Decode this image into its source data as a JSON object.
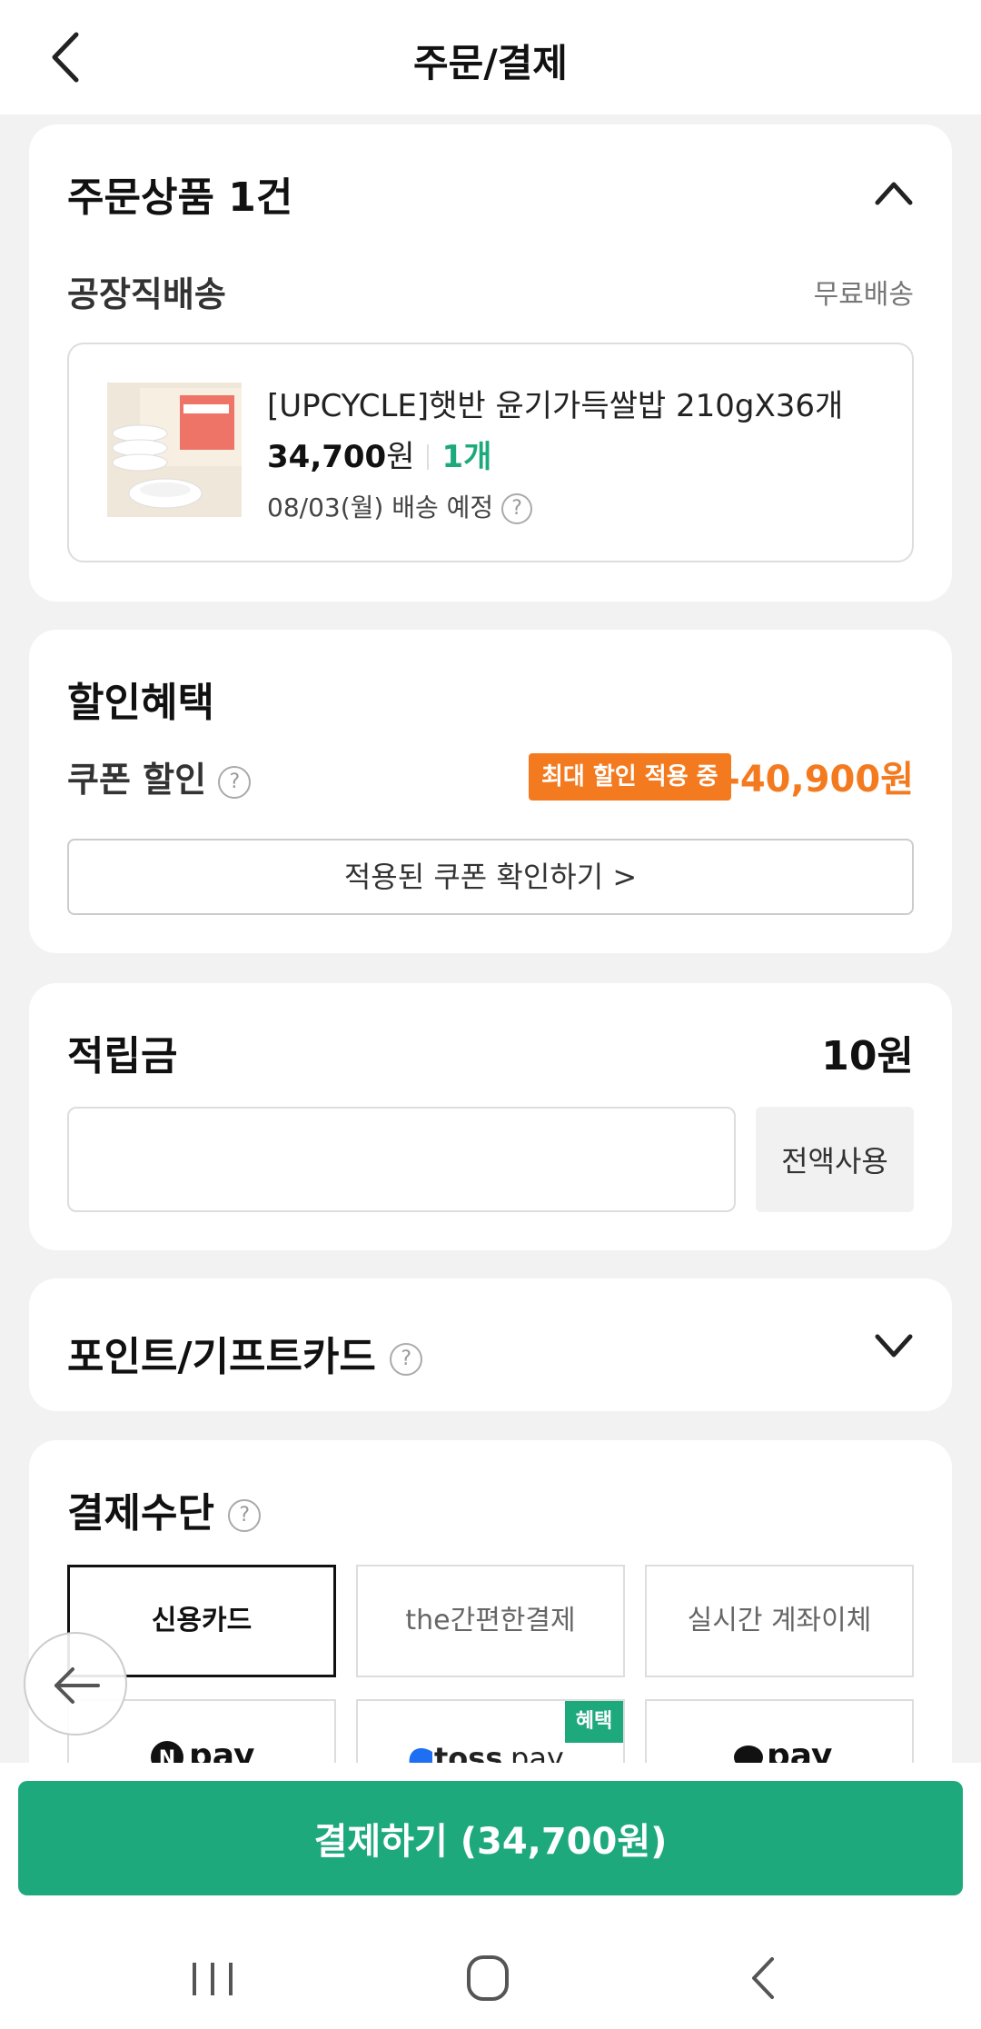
{
  "header": {
    "title": "주문/결제"
  },
  "order": {
    "title": "주문상품 1건",
    "shipping_type": "공장직배송",
    "shipping_fee": "무료배송",
    "product": {
      "name": "[UPCYCLE]햇반 윤기가득쌀밥 210gX36개",
      "price": "34,700",
      "won": "원",
      "qty": "1개",
      "delivery": "08/03(월) 배송 예정"
    }
  },
  "discount": {
    "title": "할인혜택",
    "coupon_label": "쿠폰 할인",
    "badge": "최대 할인 적용 중",
    "amount": "-40,900원",
    "check_button": "적용된 쿠폰 확인하기 >"
  },
  "reward": {
    "title": "적립금",
    "amount": "10원",
    "input_value": "",
    "use_all": "전액사용"
  },
  "points": {
    "title": "포인트/기프트카드"
  },
  "payment": {
    "title": "결제수단",
    "options": [
      "신용카드",
      "the간편한결제",
      "실시간 계좌이체"
    ],
    "selected": "신용카드",
    "logos": [
      "npay",
      "toss pay",
      "pay"
    ],
    "benefit_badge": "혜택"
  },
  "pay_button": "결제하기 (34,700원)",
  "help_glyph": "?",
  "colors": {
    "primary": "#1ea97c",
    "discount": "#f47a1f"
  }
}
